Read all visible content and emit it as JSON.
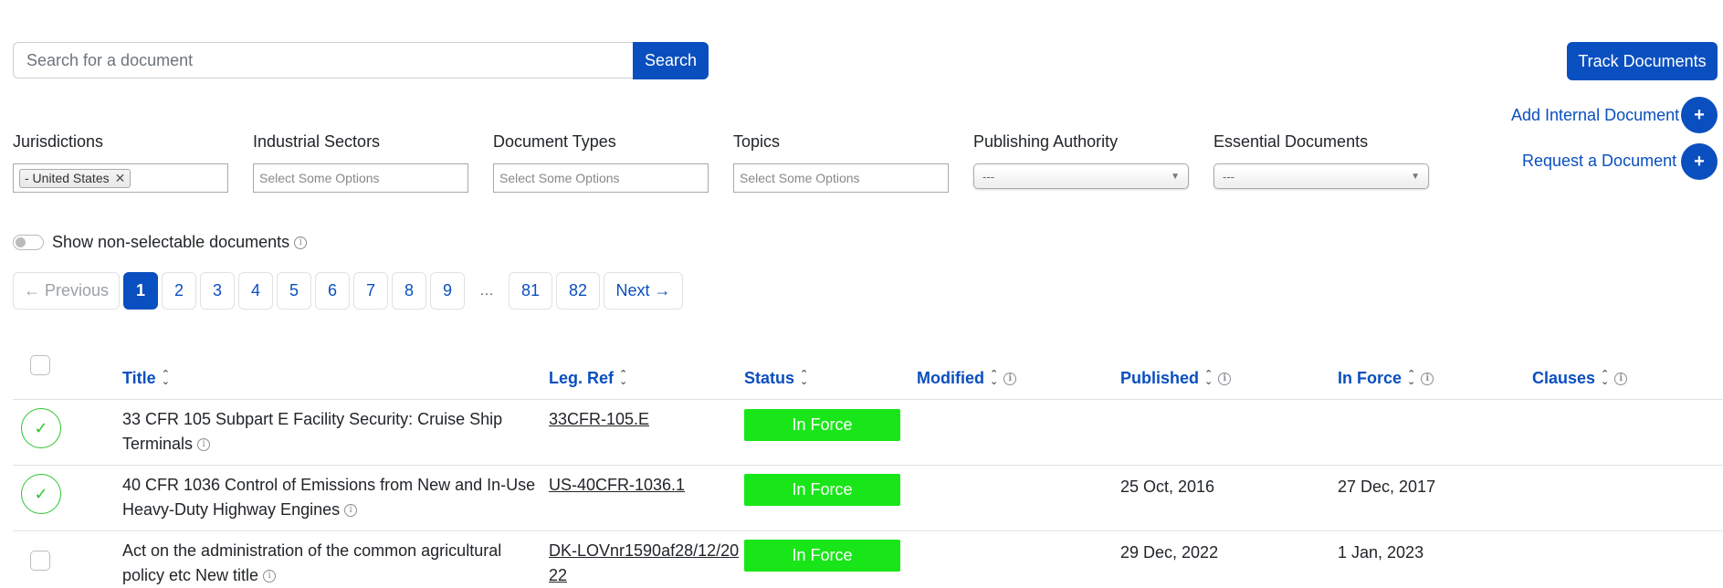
{
  "search": {
    "placeholder": "Search for a document",
    "button_label": "Search"
  },
  "track_button_label": "Track Documents",
  "filters": {
    "jurisdictions": {
      "label": "Jurisdictions",
      "selected_chip": "- United States"
    },
    "industrial_sectors": {
      "label": "Industrial Sectors",
      "placeholder": "Select Some Options"
    },
    "document_types": {
      "label": "Document Types",
      "placeholder": "Select Some Options"
    },
    "topics": {
      "label": "Topics",
      "placeholder": "Select Some Options"
    },
    "publishing_authority": {
      "label": "Publishing Authority",
      "value": "---"
    },
    "essential_documents": {
      "label": "Essential Documents",
      "value": "---"
    }
  },
  "side_actions": {
    "add_internal_document": "Add Internal Document",
    "request_document": "Request a Document"
  },
  "toggle": {
    "label": "Show non-selectable documents",
    "on": false
  },
  "pagination": {
    "previous": "← Previous",
    "next": "Next →",
    "ellipsis": "…",
    "pages": [
      "1",
      "2",
      "3",
      "4",
      "5",
      "6",
      "7",
      "8",
      "9"
    ],
    "last_pages": [
      "81",
      "82"
    ],
    "current": "1"
  },
  "table": {
    "headers": {
      "title": "Title",
      "leg_ref": "Leg. Ref",
      "status": "Status",
      "modified": "Modified",
      "published": "Published",
      "in_force": "In Force",
      "clauses": "Clauses"
    },
    "rows": [
      {
        "selected": true,
        "title": "33 CFR 105 Subpart E Facility Security: Cruise Ship Terminals",
        "leg_ref": "33CFR-105.E",
        "status": "In Force",
        "modified": "",
        "published": "",
        "in_force": ""
      },
      {
        "selected": true,
        "title": "40 CFR 1036 Control of Emissions from New and In-Use Heavy-Duty Highway Engines",
        "leg_ref": "US-40CFR-1036.1",
        "status": "In Force",
        "modified": "",
        "published": "25 Oct, 2016",
        "in_force": "27 Dec, 2017"
      },
      {
        "selected": false,
        "title": "Act on the administration of the common agricultural policy etc New title",
        "leg_ref": "DK-LOVnr1590af28/12/2022",
        "status": "In Force",
        "modified": "",
        "published": "29 Dec, 2022",
        "in_force": "1 Jan, 2023"
      }
    ]
  },
  "colors": {
    "primary": "#0a4fbf",
    "status_in_force": "#19e619",
    "check_green": "#2ec42e"
  }
}
